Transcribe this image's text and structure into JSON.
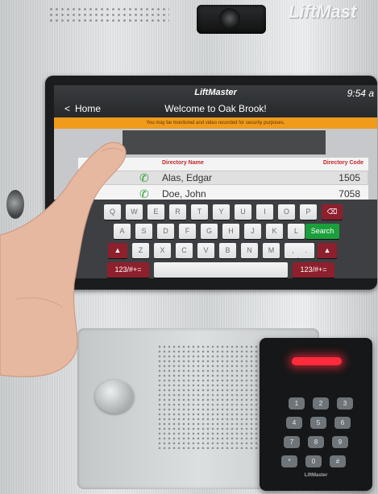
{
  "top": {
    "logo_text": "LiftMast"
  },
  "screen": {
    "brand": "LiftMaster",
    "time": "9:54 a",
    "back_label": "Home",
    "back_chevron": "<",
    "welcome": "Welcome to Oak Brook!",
    "notice": "You may be monitored and video recorded for security purposes."
  },
  "directory": {
    "col_name": "Directory Name",
    "col_code": "Directory Code",
    "rows": [
      {
        "name": "Alas, Edgar",
        "code": "1505"
      },
      {
        "name": "Doe, John",
        "code": "7058"
      }
    ]
  },
  "keyboard": {
    "row1": [
      "Q",
      "W",
      "E",
      "R",
      "T",
      "Y",
      "U",
      "I",
      "O",
      "P"
    ],
    "row2": [
      "A",
      "S",
      "D",
      "F",
      "G",
      "H",
      "J",
      "K",
      "L"
    ],
    "row3": [
      "Z",
      "X",
      "C",
      "V",
      "B",
      "N",
      "M",
      ",",
      "."
    ],
    "search": "Search",
    "mode_left": "123/#+=",
    "mode_right": "123/#+="
  },
  "icons": {
    "phone": "phone-icon",
    "backspace": "backspace-icon",
    "shift": "shift-icon"
  },
  "reader": {
    "brand": "LiftMaster",
    "keys": [
      "1",
      "2",
      "3",
      "4",
      "5",
      "6",
      "7",
      "8",
      "9",
      "*",
      "0",
      "#"
    ]
  },
  "colors": {
    "notice_bg": "#f09b1b",
    "accent_red": "#8e1f2c",
    "search_green": "#1aa03b",
    "led_red": "#ff2b3b"
  }
}
